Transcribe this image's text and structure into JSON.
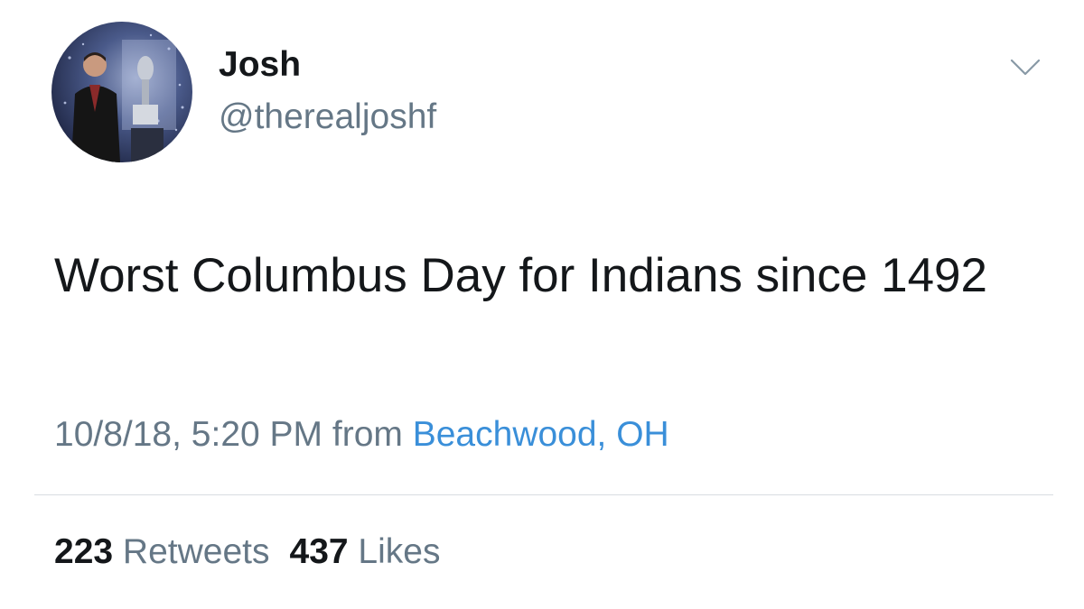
{
  "author": {
    "display_name": "Josh",
    "handle": "@therealjoshf",
    "avatar_icon": "profile-photo"
  },
  "tweet": {
    "text": "Worst Columbus Day for Indians since 1492",
    "timestamp": "10/8/18, 5:20 PM",
    "from_label": "from",
    "location": "Beachwood, OH"
  },
  "stats": {
    "retweets_count": "223",
    "retweets_label": "Retweets",
    "likes_count": "437",
    "likes_label": "Likes"
  },
  "icons": {
    "menu": "chevron-down-icon"
  },
  "colors": {
    "text_primary": "#14171a",
    "text_secondary": "#657786",
    "link": "#3a8fd9",
    "divider": "#d8dde1"
  }
}
